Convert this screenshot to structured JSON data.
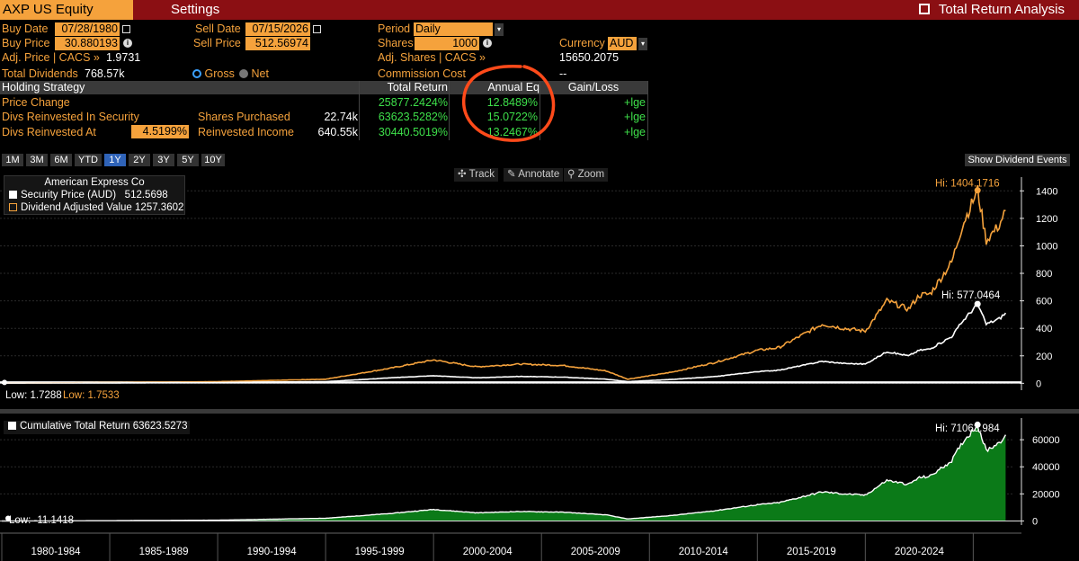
{
  "header": {
    "ticker": "AXP US Equity",
    "settings_label": "Settings",
    "title": "Total Return Analysis"
  },
  "params": {
    "buy_date_label": "Buy Date",
    "buy_date": "07/28/1980",
    "sell_date_label": "Sell Date",
    "sell_date": "07/15/2026",
    "period_label": "Period",
    "period": "Daily",
    "buy_price_label": "Buy Price",
    "buy_price": "30.880193",
    "sell_price_label": "Sell Price",
    "sell_price": "512.56974",
    "shares_label": "Shares",
    "shares": "1000",
    "currency_label": "Currency",
    "currency": "AUD",
    "adj_price_label": "Adj. Price | CACS »",
    "adj_price": "1.9731",
    "adj_shares_label": "Adj. Shares | CACS »",
    "adj_shares": "15650.2075",
    "total_div_label": "Total Dividends",
    "total_div": "768.57k",
    "gross_label": "Gross",
    "net_label": "Net",
    "commission_label": "Commission Cost",
    "commission": "--"
  },
  "table": {
    "headers": [
      "Holding Strategy",
      "Total Return",
      "Annual Eq",
      "Gain/Loss"
    ],
    "rows": [
      {
        "label": "Price Change",
        "extra_label": "",
        "extra_value": "",
        "total_return": "25877.2424%",
        "annual_eq": "12.8489%",
        "gain_loss": "+lge"
      },
      {
        "label": "Divs Reinvested In Security",
        "extra_label": "Shares Purchased",
        "extra_value": "22.74k",
        "total_return": "63623.5282%",
        "annual_eq": "15.0722%",
        "gain_loss": "+lge"
      },
      {
        "label": "Divs Reinvested At",
        "rate": "4.5199%",
        "extra_label": "Reinvested Income",
        "extra_value": "640.55k",
        "total_return": "30440.5019%",
        "annual_eq": "13.2467%",
        "gain_loss": "+lge"
      }
    ]
  },
  "ranges": [
    "1M",
    "3M",
    "6M",
    "YTD",
    "1Y",
    "2Y",
    "3Y",
    "5Y",
    "10Y"
  ],
  "selected_range": "1Y",
  "show_dividend_label": "Show Dividend Events",
  "tools": {
    "track": "Track",
    "annotate": "Annotate",
    "zoom": "Zoom"
  },
  "colors": {
    "accent": "#f5a23c",
    "header_bg": "#8b0f13",
    "green": "#3ee04a",
    "fill_green": "#0b7a18",
    "circle": "#ff4a1a"
  },
  "chart_data": [
    {
      "type": "line",
      "legend_title": "American Express Co",
      "series": [
        {
          "name": "Security Price (AUD)",
          "last": "512.5698",
          "color": "#ffffff",
          "x": [
            1980,
            1985,
            1990,
            1995,
            1998,
            2000,
            2002,
            2004,
            2006,
            2008,
            2009,
            2011,
            2013,
            2015,
            2016,
            2018,
            2019,
            2020,
            2021,
            2022,
            2022.5,
            2023,
            2024,
            2024.5,
            2025.2,
            2025.6,
            2026.2,
            2026.5
          ],
          "y": [
            1.73,
            3,
            6,
            12,
            40,
            55,
            40,
            50,
            45,
            30,
            12,
            28,
            48,
            85,
            95,
            160,
            145,
            140,
            230,
            200,
            240,
            250,
            340,
            450,
            577,
            430,
            470,
            512
          ]
        },
        {
          "name": "Dividend Adjusted Value",
          "last": "1257.3602",
          "color": "#f5a23c",
          "x": [
            1980,
            1985,
            1990,
            1995,
            1998,
            2000,
            2002,
            2004,
            2006,
            2008,
            2009,
            2011,
            2013,
            2015,
            2016,
            2018,
            2019,
            2020,
            2021,
            2022,
            2022.5,
            2023,
            2024,
            2024.5,
            2025.2,
            2025.6,
            2026.2,
            2026.5
          ],
          "y": [
            1.75,
            5,
            12,
            30,
            110,
            170,
            120,
            140,
            130,
            90,
            30,
            80,
            150,
            240,
            260,
            430,
            400,
            380,
            600,
            540,
            640,
            650,
            880,
            1150,
            1404,
            1040,
            1150,
            1257
          ]
        }
      ],
      "hi_white": "Hi: 577.0464",
      "hi_orange": "Hi: 1404.1716",
      "low_white": "Low: 1.7288",
      "low_orange": "Low: 1.7533",
      "y_ticks": [
        0,
        200,
        400,
        600,
        800,
        1000,
        1200,
        1400
      ],
      "ylim": [
        -50,
        1500
      ]
    },
    {
      "type": "area",
      "series": [
        {
          "name": "Cumulative Total Return",
          "last": "63623.5273",
          "x": [
            1980,
            1985,
            1990,
            1995,
            1998,
            2000,
            2002,
            2004,
            2006,
            2008,
            2009,
            2011,
            2013,
            2015,
            2016,
            2018,
            2019,
            2020,
            2021,
            2022,
            2022.5,
            2023,
            2024,
            2024.5,
            2025.2,
            2025.6,
            2026.2,
            2026.5
          ],
          "y": [
            -11,
            200,
            600,
            2000,
            5500,
            8500,
            6000,
            7000,
            6500,
            4500,
            1500,
            4000,
            7500,
            12000,
            13500,
            21500,
            20000,
            19000,
            30000,
            27000,
            32000,
            33000,
            44500,
            58000,
            71064,
            52000,
            58000,
            63624
          ]
        }
      ],
      "hi": "Hi: 71063.984",
      "low": "Low: -11.1418",
      "y_ticks": [
        0,
        20000,
        40000,
        60000
      ],
      "ylim": [
        -3000,
        76000
      ]
    }
  ],
  "x_axis": {
    "categories": [
      "1980-1984",
      "1985-1989",
      "1990-1994",
      "1995-1999",
      "2000-2004",
      "2005-2009",
      "2010-2014",
      "2015-2019",
      "2020-2024"
    ],
    "xlim": [
      1980,
      2026.9
    ]
  }
}
